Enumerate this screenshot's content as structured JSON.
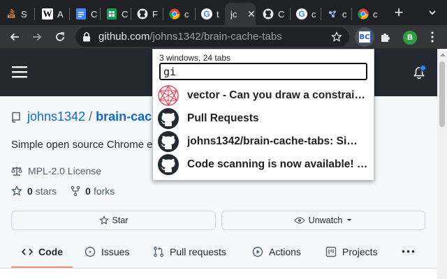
{
  "tabs": [
    {
      "title": "S",
      "icon": "stack-overflow-icon"
    },
    {
      "title": "A",
      "icon": "wikipedia-icon"
    },
    {
      "title": "C",
      "icon": "google-docs-icon"
    },
    {
      "title": "C",
      "icon": "google-sheets-icon"
    },
    {
      "title": "F",
      "icon": "github-icon"
    },
    {
      "title": "c",
      "icon": "chrome-icon"
    },
    {
      "title": "t",
      "icon": "google-icon"
    },
    {
      "title": "jc",
      "icon": "none",
      "active": true,
      "close": "✕"
    },
    {
      "title": "C",
      "icon": "github-icon"
    },
    {
      "title": "c",
      "icon": "google-icon"
    },
    {
      "title": "c",
      "icon": "brain-cache-icon"
    },
    {
      "title": "c",
      "icon": "chrome-icon"
    }
  ],
  "new_tab_label": "+",
  "omnibox": {
    "host": "github.com",
    "path": "/johns1342/brain-cache-tabs"
  },
  "extension": {
    "badge": "BC"
  },
  "profile": {
    "initial": "B",
    "color": "#2d9f43"
  },
  "popup": {
    "info": "3 windows, 24 tabs",
    "query": "gi",
    "results": [
      {
        "title": "vector - Can you draw a constraint…",
        "icon": "geometry-icon"
      },
      {
        "title": "Pull Requests",
        "icon": "github-icon"
      },
      {
        "title": "johns1342/brain-cache-tabs: Si…",
        "icon": "github-icon"
      },
      {
        "title": "Code scanning is now available! …",
        "icon": "github-icon"
      }
    ]
  },
  "repo": {
    "owner": "johns1342",
    "slash": "/",
    "name": "brain-cache-tabs",
    "description": "Simple open source Chrome extension",
    "license": "MPL-2.0 License",
    "stars_count": "0",
    "stars_label": "stars",
    "forks_count": "0",
    "forks_label": "forks",
    "star_button": "Star",
    "watch_button": "Unwatch"
  },
  "repo_nav": [
    {
      "label": "Code",
      "icon": "code-icon",
      "active": true
    },
    {
      "label": "Issues",
      "icon": "issues-icon"
    },
    {
      "label": "Pull requests",
      "icon": "pull-request-icon"
    },
    {
      "label": "Actions",
      "icon": "actions-icon"
    },
    {
      "label": "Projects",
      "icon": "projects-icon"
    }
  ],
  "colors": {
    "chrome_dark": "#202124",
    "chrome_toolbar": "#35363a",
    "github_header": "#24292f",
    "link_blue": "#0969da",
    "tab_underline": "#fd8c73",
    "notification_dot": "#2f81f7"
  }
}
